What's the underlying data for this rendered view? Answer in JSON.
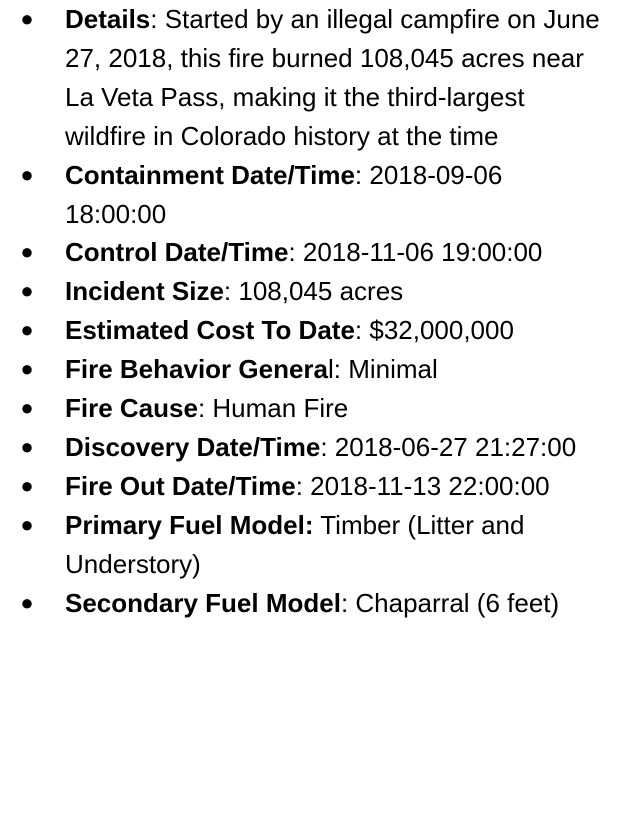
{
  "items": [
    {
      "bold": "Details",
      "rest": ": Started by an illegal campfire on June 27, 2018, this fire burned 108,045 acres near La Veta Pass, making it the third-largest wildfire in Colorado history at the time"
    },
    {
      "bold": "Containment Date/Time",
      "rest": ": 2018-09-06 18:00:00"
    },
    {
      "bold": "Control Date/Time",
      "rest": ": 2018-11-06 19:00:00"
    },
    {
      "bold": "Incident Size",
      "rest": ": 108,045 acres"
    },
    {
      "bold": "Estimated Cost To Date",
      "rest": ": $32,000,000"
    },
    {
      "bold": "Fire Behavior Genera",
      "rest": "l: Minimal"
    },
    {
      "bold": "Fire Cause",
      "rest": ": Human Fire"
    },
    {
      "bold": "Discovery Date/Time",
      "rest": ": 2018-06-27 21:27:00"
    },
    {
      "bold": "Fire Out Date/Time",
      "rest": ": 2018-11-13 22:00:00"
    },
    {
      "bold": "Primary Fuel Model:",
      "rest": " Timber (Litter and Understory)"
    },
    {
      "bold": "Secondary Fuel Model",
      "rest": ": Chaparral (6 feet)"
    }
  ]
}
